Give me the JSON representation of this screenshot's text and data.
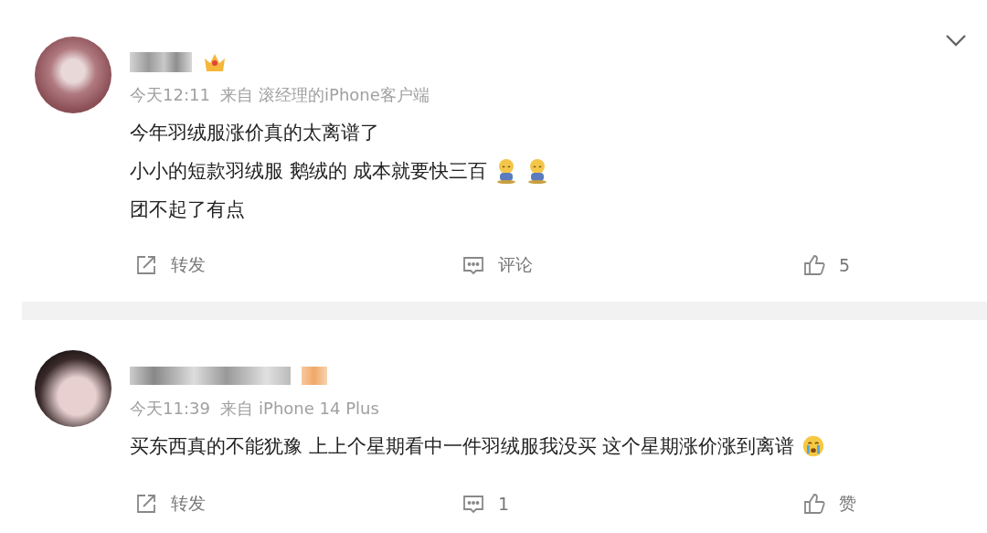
{
  "comments": [
    {
      "collapse_menu": true,
      "badge": {
        "kind": "crown"
      },
      "time": "今天12:11",
      "source": "来自 滚经理的iPhone客户端",
      "lines": [
        {
          "text": "今年羽绒服涨价真的太离谱了"
        },
        {
          "text": "小小的短款羽绒服 鹅绒的 成本就要快三百",
          "emojis": [
            {
              "kind": "sitting"
            },
            {
              "kind": "sitting"
            }
          ]
        },
        {
          "text": "团不起了有点"
        }
      ],
      "actions": [
        {
          "kind": "repost",
          "label": "转发"
        },
        {
          "kind": "comment",
          "label": "评论"
        },
        {
          "kind": "like",
          "label": "5"
        }
      ]
    },
    {
      "collapse_menu": false,
      "badge": {
        "kind": "blurred"
      },
      "time": "今天11:39",
      "source": "来自 iPhone 14 Plus",
      "lines": [
        {
          "text": "买东西真的不能犹豫 上上个星期看中一件羽绒服我没买 这个星期涨价涨到离谱",
          "emojis": [
            {
              "kind": "crying"
            }
          ]
        }
      ],
      "actions": [
        {
          "kind": "repost",
          "label": "转发"
        },
        {
          "kind": "comment",
          "label": "1"
        },
        {
          "kind": "like",
          "label": "赞"
        }
      ]
    }
  ]
}
